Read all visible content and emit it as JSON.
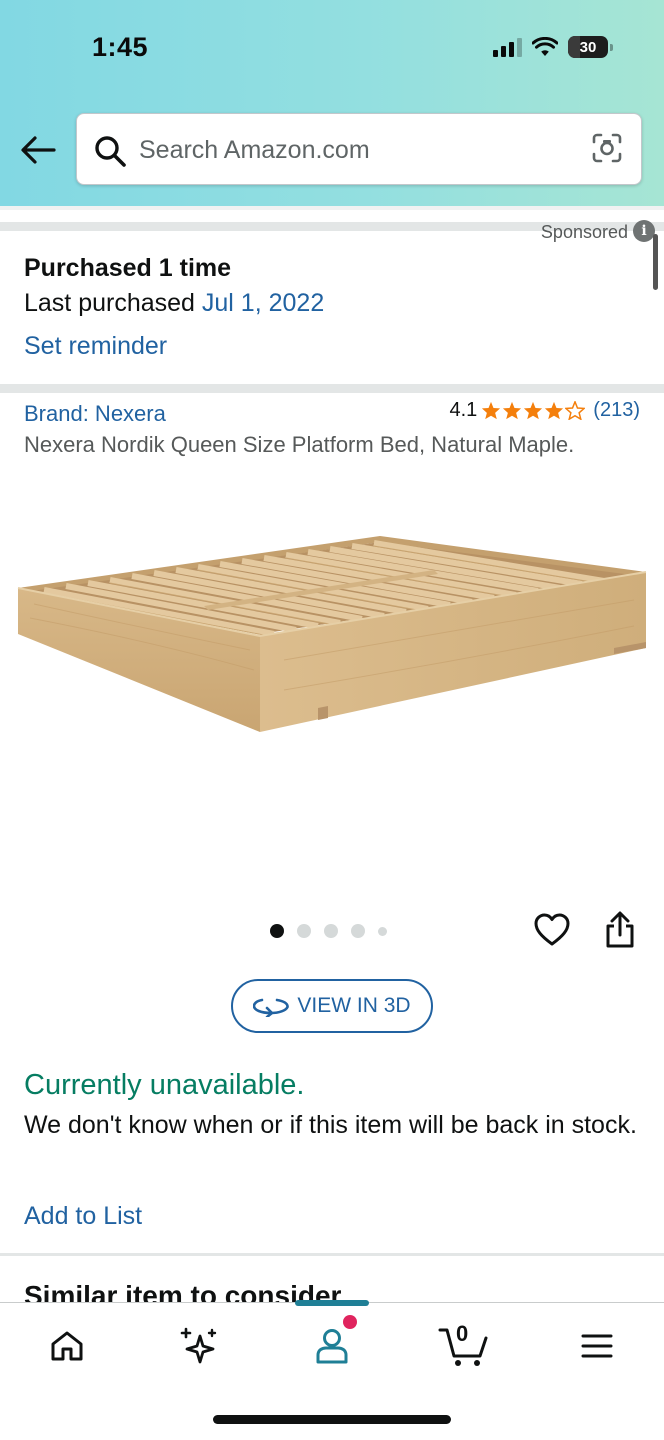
{
  "status_bar": {
    "time": "1:45",
    "battery_level": "30",
    "icons": [
      "signal-icon",
      "wifi-icon",
      "battery-icon"
    ]
  },
  "search": {
    "placeholder": "Search Amazon.com",
    "icons": [
      "back-arrow-icon",
      "search-icon",
      "camera-scan-icon"
    ]
  },
  "sponsored": {
    "label": "Sponsored",
    "info_glyph": "i"
  },
  "purchase_history": {
    "title": "Purchased 1 time",
    "last_purchased_label": "Last purchased",
    "last_purchased_date": "Jul 1, 2022",
    "set_reminder": "Set reminder"
  },
  "product": {
    "brand": "Brand: Nexera",
    "rating_value": "4.1",
    "rating_stars": 4,
    "rating_max": 5,
    "rating_count": "(213)",
    "title": "Nexera Nordik Queen Size Platform Bed, Natural Maple.",
    "image_icon": "platform-bed-image",
    "image_count": 5,
    "active_image_index": 0,
    "view_3d_label": "VIEW IN 3D"
  },
  "availability": {
    "status": "Currently unavailable.",
    "message": "We don't know when or if this item will be back in stock.",
    "add_to_list": "Add to List"
  },
  "similar": {
    "heading": "Similar item to consider"
  },
  "bottom_nav": {
    "items": [
      {
        "name": "home",
        "icon": "home-icon"
      },
      {
        "name": "rufus",
        "icon": "sparkle-icon"
      },
      {
        "name": "account",
        "icon": "person-icon",
        "active": true
      },
      {
        "name": "cart",
        "icon": "cart-icon",
        "count": "0"
      },
      {
        "name": "menu",
        "icon": "menu-icon"
      }
    ]
  },
  "colors": {
    "link": "#2162a1",
    "in_stock_green": "#067d62",
    "star": "#f47f0c",
    "header_gradient_start": "#82d8e3",
    "header_gradient_end": "#a6e5d4",
    "nav_active": "#1f7f96",
    "badge": "#e0245e"
  }
}
